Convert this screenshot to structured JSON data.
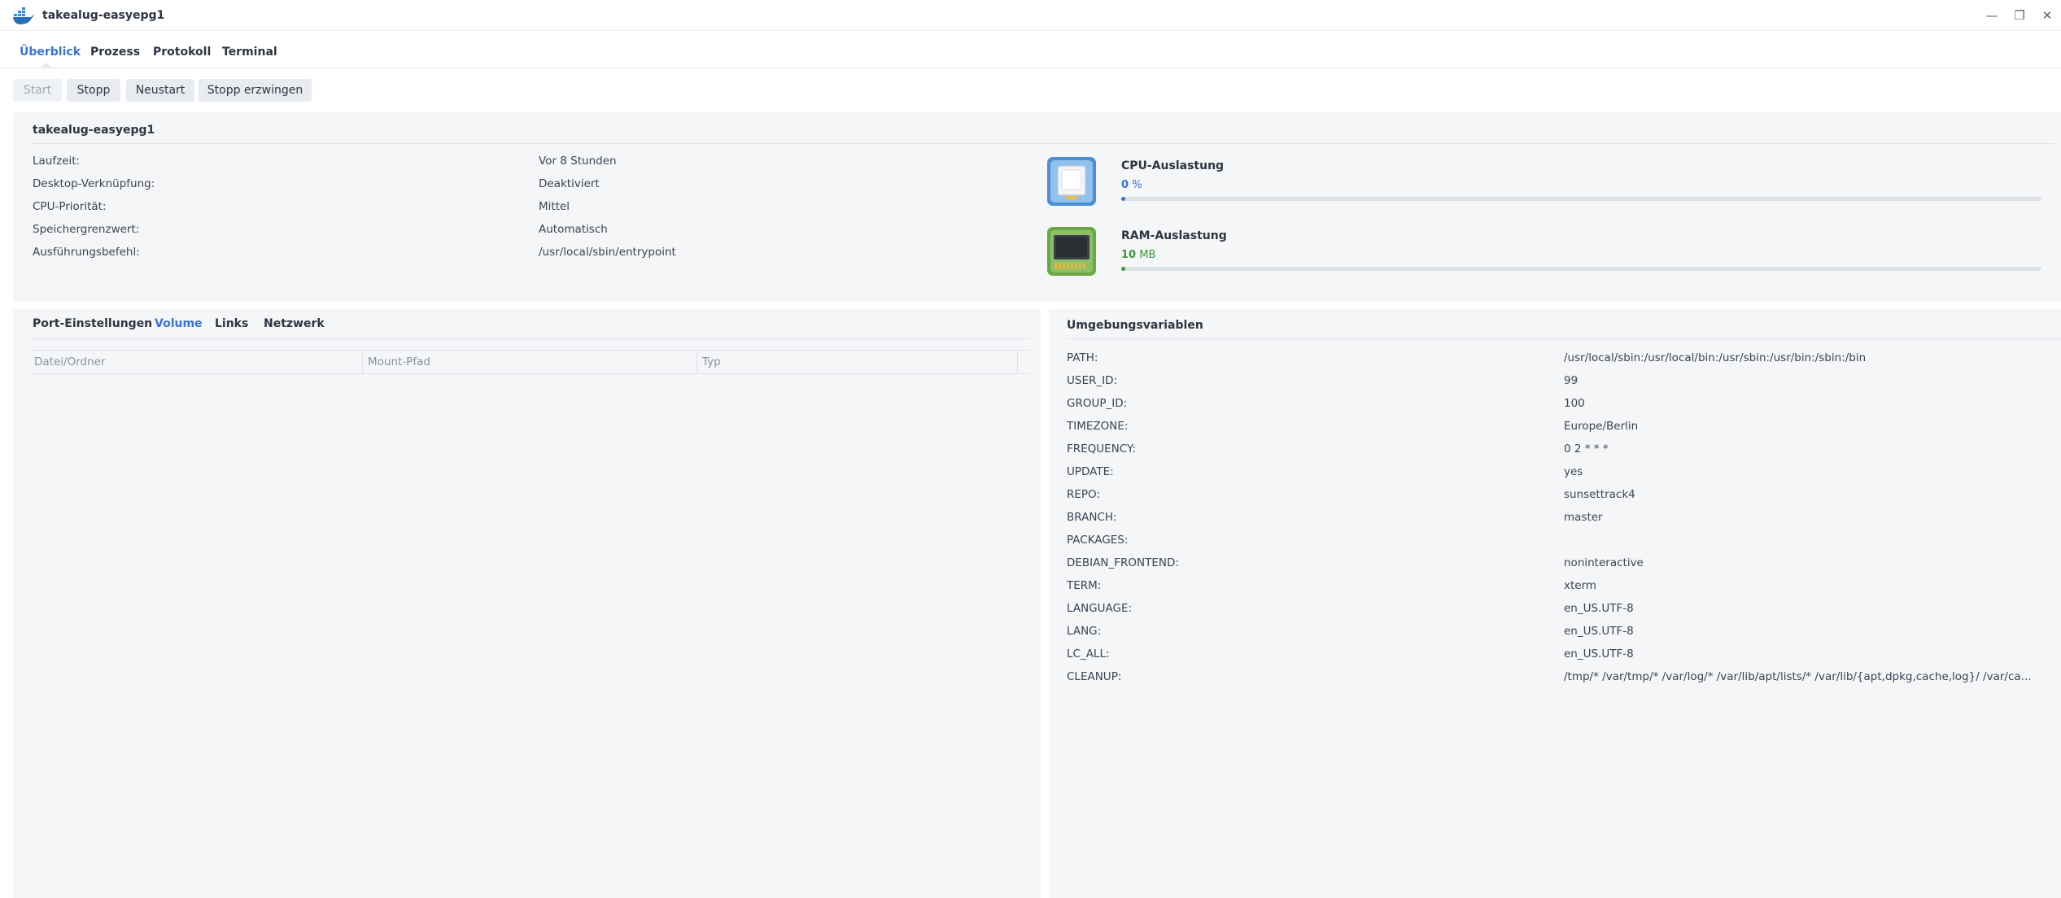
{
  "window": {
    "title": "takealug-easyepg1"
  },
  "tabs": [
    {
      "label": "Überblick",
      "active": true
    },
    {
      "label": "Prozess",
      "active": false
    },
    {
      "label": "Protokoll",
      "active": false
    },
    {
      "label": "Terminal",
      "active": false
    }
  ],
  "toolbar": {
    "start": "Start",
    "stop": "Stopp",
    "restart": "Neustart",
    "force_stop": "Stopp erzwingen"
  },
  "overview": {
    "name": "takealug-easyepg1",
    "rows": [
      {
        "label": "Laufzeit:",
        "value": "Vor 8 Stunden"
      },
      {
        "label": "Desktop-Verknüpfung:",
        "value": "Deaktiviert"
      },
      {
        "label": "CPU-Priorität:",
        "value": "Mittel"
      },
      {
        "label": "Speichergrenzwert:",
        "value": "Automatisch"
      },
      {
        "label": "Ausführungsbefehl:",
        "value": "/usr/local/sbin/entrypoint"
      }
    ],
    "cpu": {
      "label": "CPU-Auslastung",
      "value": "0",
      "unit": "%",
      "percent": 0,
      "color": "#3873d8"
    },
    "ram": {
      "label": "RAM-Auslastung",
      "value": "10",
      "unit": "MB",
      "percent": 0,
      "color": "#3a9a3a"
    }
  },
  "subtabs": [
    {
      "label": "Port-Einstellungen",
      "active": false
    },
    {
      "label": "Volume",
      "active": true
    },
    {
      "label": "Links",
      "active": false
    },
    {
      "label": "Netzwerk",
      "active": false
    }
  ],
  "volume_table": {
    "columns": [
      "Datei/Ordner",
      "Mount-Pfad",
      "Typ"
    ]
  },
  "env": {
    "title": "Umgebungsvariablen",
    "rows": [
      {
        "label": "PATH:",
        "value": "/usr/local/sbin:/usr/local/bin:/usr/sbin:/usr/bin:/sbin:/bin"
      },
      {
        "label": "USER_ID:",
        "value": "99"
      },
      {
        "label": "GROUP_ID:",
        "value": "100"
      },
      {
        "label": "TIMEZONE:",
        "value": "Europe/Berlin"
      },
      {
        "label": "FREQUENCY:",
        "value": "0 2 * * *"
      },
      {
        "label": "UPDATE:",
        "value": "yes"
      },
      {
        "label": "REPO:",
        "value": "sunsettrack4"
      },
      {
        "label": "BRANCH:",
        "value": "master"
      },
      {
        "label": "PACKAGES:",
        "value": ""
      },
      {
        "label": "DEBIAN_FRONTEND:",
        "value": "noninteractive"
      },
      {
        "label": "TERM:",
        "value": "xterm"
      },
      {
        "label": "LANGUAGE:",
        "value": "en_US.UTF-8"
      },
      {
        "label": "LANG:",
        "value": "en_US.UTF-8"
      },
      {
        "label": "LC_ALL:",
        "value": "en_US.UTF-8"
      },
      {
        "label": "CLEANUP:",
        "value": "/tmp/* /var/tmp/* /var/log/* /var/lib/apt/lists/* /var/lib/{apt,dpkg,cache,log}/ /var/ca..."
      }
    ]
  },
  "colors": {
    "accent": "#3873d8",
    "panel": "#f4f6f8"
  }
}
